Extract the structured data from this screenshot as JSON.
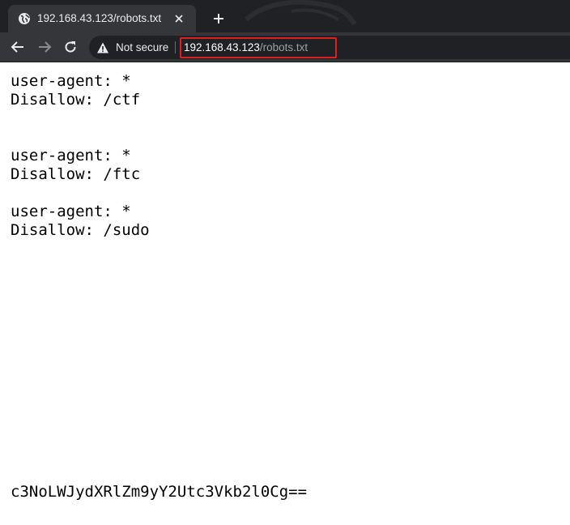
{
  "tab": {
    "title": "192.168.43.123/robots.txt",
    "favicon": "globe-icon"
  },
  "toolbar": {
    "back_icon": "arrow-left-icon",
    "forward_icon": "arrow-right-icon",
    "reload_icon": "reload-icon",
    "security_icon": "warning-triangle-icon",
    "security_label": "Not secure",
    "url_host": "192.168.43.123",
    "url_path": "/robots.txt",
    "highlight_color": "#e01f1f"
  },
  "content": {
    "lines": [
      "user-agent: *",
      "Disallow: /ctf",
      "",
      "",
      "user-agent: *",
      "Disallow: /ftc",
      "",
      "user-agent: *",
      "Disallow: /sudo"
    ],
    "encoded_string": "c3NoLWJydXRlZm9yY2Utc3Vkb2l0Cg=="
  },
  "colors": {
    "tabbar_bg": "#202124",
    "toolbar_bg": "#35363a",
    "text": "#e8eaed"
  }
}
